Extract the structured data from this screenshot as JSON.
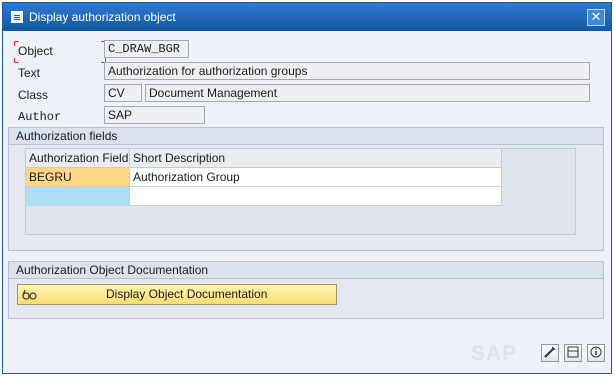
{
  "window": {
    "title": "Display authorization object",
    "close_glyph": "✕"
  },
  "form": {
    "object_label": "Object",
    "object_value": "C_DRAW_BGR",
    "text_label": "Text",
    "text_value": "Authorization for authorization groups",
    "class_label": "Class",
    "class_value": "CV",
    "class_description": "Document Management",
    "author_label": "Author",
    "author_value": "SAP"
  },
  "auth_fields": {
    "title": "Authorization fields",
    "columns": [
      "Authorization Field",
      "Short Description"
    ],
    "rows": [
      {
        "field": "BEGRU",
        "description": "Authorization Group"
      }
    ]
  },
  "documentation": {
    "title": "Authorization Object Documentation",
    "button_label": "Display Object Documentation",
    "button_icon": "documentation-glasses-icon"
  },
  "statusbar": {
    "watermark": "SAP",
    "edit_icon": "pencil-icon",
    "layout_icon": "layout-icon",
    "info_icon": "info-icon"
  },
  "colors": {
    "titlebar": "#1d5aa3",
    "key_cell": "#ffd686",
    "selected_cell": "#aee0f4",
    "doc_button": "#f6de72",
    "focus_corners": "#d8323c"
  }
}
